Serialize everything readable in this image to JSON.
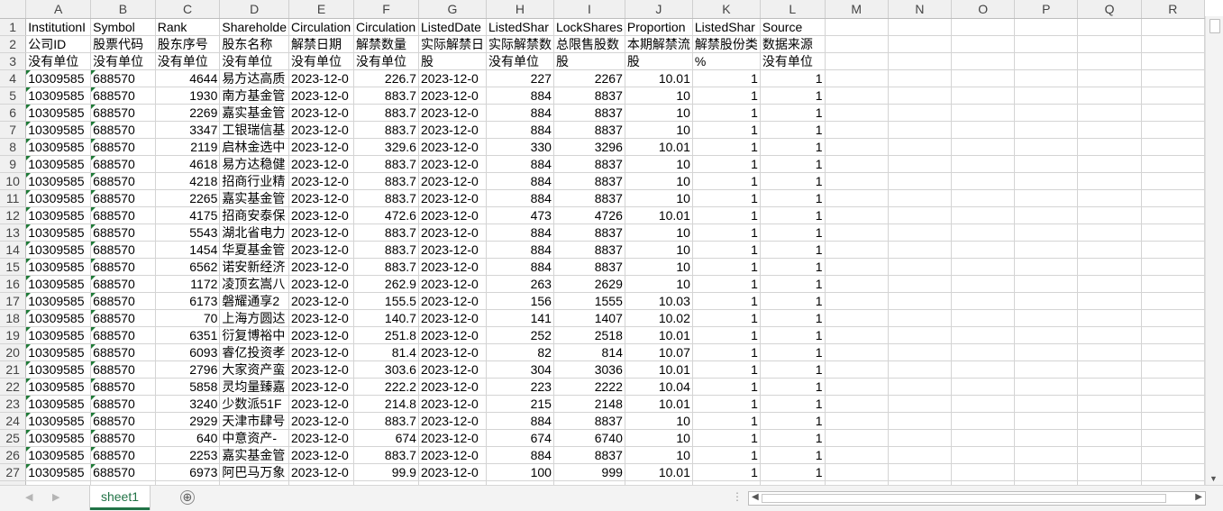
{
  "columns": [
    "A",
    "B",
    "C",
    "D",
    "E",
    "F",
    "G",
    "H",
    "I",
    "J",
    "K",
    "L",
    "M",
    "N",
    "O",
    "P",
    "Q",
    "R"
  ],
  "header_rows": [
    [
      "InstitutionI",
      "Symbol",
      "Rank",
      "Shareholde",
      "Circulation",
      "Circulation",
      "ListedDate",
      "ListedShar",
      "LockShares",
      "Proportion",
      "ListedShar",
      "Source"
    ],
    [
      "公司ID",
      "股票代码",
      "股东序号",
      "股东名称",
      "解禁日期",
      "解禁数量",
      "实际解禁日",
      "实际解禁数",
      "总限售股数",
      "本期解禁流",
      "解禁股份类",
      "数据来源"
    ],
    [
      "没有单位",
      "没有单位",
      "没有单位",
      "没有单位",
      "没有单位",
      "没有单位",
      "股",
      "没有单位",
      "股",
      "股",
      "%",
      "没有单位"
    ]
  ],
  "data_rows": [
    [
      "10309585",
      "688570",
      "4644",
      "易方达高质",
      "2023-12-0",
      "226.7",
      "2023-12-0",
      "227",
      "2267",
      "10.01",
      "1",
      "1"
    ],
    [
      "10309585",
      "688570",
      "1930",
      "南方基金管",
      "2023-12-0",
      "883.7",
      "2023-12-0",
      "884",
      "8837",
      "10",
      "1",
      "1"
    ],
    [
      "10309585",
      "688570",
      "2269",
      "嘉实基金管",
      "2023-12-0",
      "883.7",
      "2023-12-0",
      "884",
      "8837",
      "10",
      "1",
      "1"
    ],
    [
      "10309585",
      "688570",
      "3347",
      "工银瑞信基",
      "2023-12-0",
      "883.7",
      "2023-12-0",
      "884",
      "8837",
      "10",
      "1",
      "1"
    ],
    [
      "10309585",
      "688570",
      "2119",
      "启林金选中",
      "2023-12-0",
      "329.6",
      "2023-12-0",
      "330",
      "3296",
      "10.01",
      "1",
      "1"
    ],
    [
      "10309585",
      "688570",
      "4618",
      "易方达稳健",
      "2023-12-0",
      "883.7",
      "2023-12-0",
      "884",
      "8837",
      "10",
      "1",
      "1"
    ],
    [
      "10309585",
      "688570",
      "4218",
      "招商行业精",
      "2023-12-0",
      "883.7",
      "2023-12-0",
      "884",
      "8837",
      "10",
      "1",
      "1"
    ],
    [
      "10309585",
      "688570",
      "2265",
      "嘉实基金管",
      "2023-12-0",
      "883.7",
      "2023-12-0",
      "884",
      "8837",
      "10",
      "1",
      "1"
    ],
    [
      "10309585",
      "688570",
      "4175",
      "招商安泰保",
      "2023-12-0",
      "472.6",
      "2023-12-0",
      "473",
      "4726",
      "10.01",
      "1",
      "1"
    ],
    [
      "10309585",
      "688570",
      "5543",
      "湖北省电力",
      "2023-12-0",
      "883.7",
      "2023-12-0",
      "884",
      "8837",
      "10",
      "1",
      "1"
    ],
    [
      "10309585",
      "688570",
      "1454",
      "华夏基金管",
      "2023-12-0",
      "883.7",
      "2023-12-0",
      "884",
      "8837",
      "10",
      "1",
      "1"
    ],
    [
      "10309585",
      "688570",
      "6562",
      "诺安新经济",
      "2023-12-0",
      "883.7",
      "2023-12-0",
      "884",
      "8837",
      "10",
      "1",
      "1"
    ],
    [
      "10309585",
      "688570",
      "1172",
      "凌顶玄嵩八",
      "2023-12-0",
      "262.9",
      "2023-12-0",
      "263",
      "2629",
      "10",
      "1",
      "1"
    ],
    [
      "10309585",
      "688570",
      "6173",
      "磐耀通享2",
      "2023-12-0",
      "155.5",
      "2023-12-0",
      "156",
      "1555",
      "10.03",
      "1",
      "1"
    ],
    [
      "10309585",
      "688570",
      "70",
      "上海方圆达",
      "2023-12-0",
      "140.7",
      "2023-12-0",
      "141",
      "1407",
      "10.02",
      "1",
      "1"
    ],
    [
      "10309585",
      "688570",
      "6351",
      "衍复博裕中",
      "2023-12-0",
      "251.8",
      "2023-12-0",
      "252",
      "2518",
      "10.01",
      "1",
      "1"
    ],
    [
      "10309585",
      "688570",
      "6093",
      "睿亿投资孝",
      "2023-12-0",
      "81.4",
      "2023-12-0",
      "82",
      "814",
      "10.07",
      "1",
      "1"
    ],
    [
      "10309585",
      "688570",
      "2796",
      "大家资产蛮",
      "2023-12-0",
      "303.6",
      "2023-12-0",
      "304",
      "3036",
      "10.01",
      "1",
      "1"
    ],
    [
      "10309585",
      "688570",
      "5858",
      "灵均量臻嘉",
      "2023-12-0",
      "222.2",
      "2023-12-0",
      "223",
      "2222",
      "10.04",
      "1",
      "1"
    ],
    [
      "10309585",
      "688570",
      "3240",
      "少数派51F",
      "2023-12-0",
      "214.8",
      "2023-12-0",
      "215",
      "2148",
      "10.01",
      "1",
      "1"
    ],
    [
      "10309585",
      "688570",
      "2929",
      "天津市肆号",
      "2023-12-0",
      "883.7",
      "2023-12-0",
      "884",
      "8837",
      "10",
      "1",
      "1"
    ],
    [
      "10309585",
      "688570",
      "640",
      "中意资产-",
      "2023-12-0",
      "674",
      "2023-12-0",
      "674",
      "6740",
      "10",
      "1",
      "1"
    ],
    [
      "10309585",
      "688570",
      "2253",
      "嘉实基金管",
      "2023-12-0",
      "883.7",
      "2023-12-0",
      "884",
      "8837",
      "10",
      "1",
      "1"
    ],
    [
      "10309585",
      "688570",
      "6973",
      "阿巴马万象",
      "2023-12-0",
      "99.9",
      "2023-12-0",
      "100",
      "999",
      "10.01",
      "1",
      "1"
    ]
  ],
  "numeric_columns": [
    2,
    5,
    7,
    8,
    9,
    10,
    11
  ],
  "flagged_columns": [
    0,
    1
  ],
  "sheet_tab": "sheet1",
  "add_sheet_symbol": "⊕",
  "accent_color": "#217346"
}
